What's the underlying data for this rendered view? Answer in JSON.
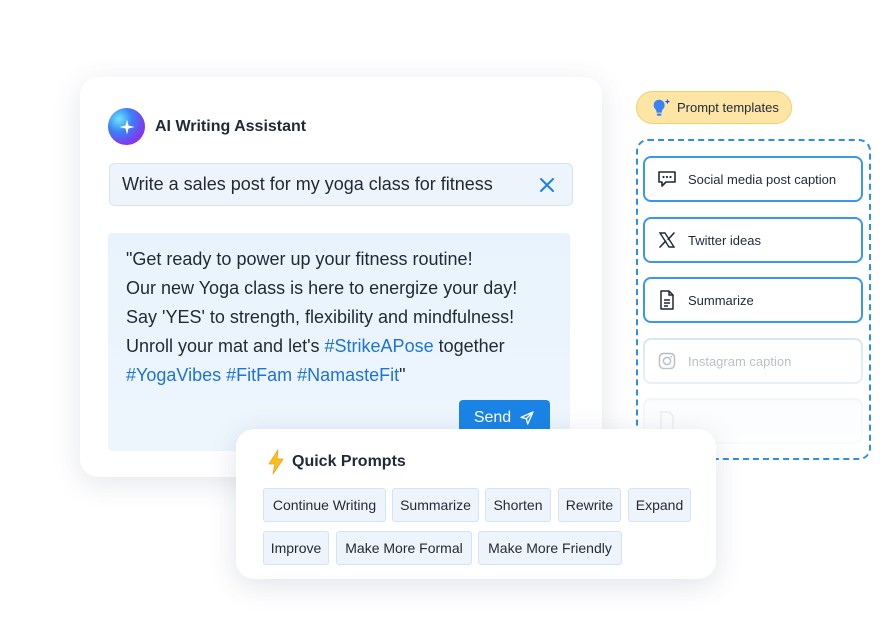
{
  "assistant": {
    "title": "AI Writing Assistant",
    "prompt_value": "Write a sales post for my yoga class for fitness",
    "response": {
      "line1": "\"Get ready to power up your fitness routine!",
      "line2": "Our new Yoga class is here to energize your day!",
      "line3": "Say 'YES' to strength, flexibility and mindfulness!",
      "line4_prefix": "Unroll your mat and let's ",
      "line4_tag": "#StrikeAPose",
      "line4_suffix": " together",
      "line5_tags": " #YogaVibes #FitFam #NamasteFit",
      "line5_suffix": "\""
    },
    "send_label": "Send"
  },
  "templates": {
    "pill_label": "Prompt templates",
    "items": [
      {
        "label": "Social media post caption",
        "icon": "chat-bubble-icon"
      },
      {
        "label": "Twitter ideas",
        "icon": "x-logo-icon"
      },
      {
        "label": "Summarize",
        "icon": "document-icon"
      },
      {
        "label": "Instagram caption",
        "icon": "instagram-icon"
      }
    ]
  },
  "quick_prompts": {
    "title": "Quick Prompts",
    "chips": [
      "Continue Writing",
      "Summarize",
      "Shorten",
      "Rewrite",
      "Expand",
      "Improve",
      "Make More Formal",
      "Make More Friendly"
    ]
  },
  "colors": {
    "accent": "#1a84e6",
    "hashtag": "#1d73d6",
    "pill": "#fde6a5",
    "input_bg": "#eef4fb"
  }
}
